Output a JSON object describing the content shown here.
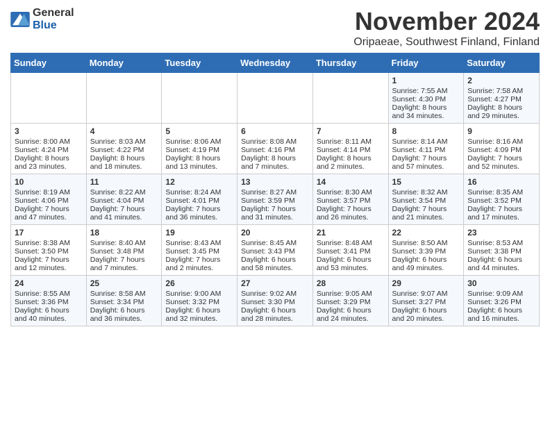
{
  "header": {
    "logo_general": "General",
    "logo_blue": "Blue",
    "title": "November 2024",
    "subtitle": "Oripaeae, Southwest Finland, Finland"
  },
  "columns": [
    "Sunday",
    "Monday",
    "Tuesday",
    "Wednesday",
    "Thursday",
    "Friday",
    "Saturday"
  ],
  "weeks": [
    [
      {
        "day": "",
        "text": ""
      },
      {
        "day": "",
        "text": ""
      },
      {
        "day": "",
        "text": ""
      },
      {
        "day": "",
        "text": ""
      },
      {
        "day": "",
        "text": ""
      },
      {
        "day": "1",
        "text": "Sunrise: 7:55 AM\nSunset: 4:30 PM\nDaylight: 8 hours\nand 34 minutes."
      },
      {
        "day": "2",
        "text": "Sunrise: 7:58 AM\nSunset: 4:27 PM\nDaylight: 8 hours\nand 29 minutes."
      }
    ],
    [
      {
        "day": "3",
        "text": "Sunrise: 8:00 AM\nSunset: 4:24 PM\nDaylight: 8 hours\nand 23 minutes."
      },
      {
        "day": "4",
        "text": "Sunrise: 8:03 AM\nSunset: 4:22 PM\nDaylight: 8 hours\nand 18 minutes."
      },
      {
        "day": "5",
        "text": "Sunrise: 8:06 AM\nSunset: 4:19 PM\nDaylight: 8 hours\nand 13 minutes."
      },
      {
        "day": "6",
        "text": "Sunrise: 8:08 AM\nSunset: 4:16 PM\nDaylight: 8 hours\nand 7 minutes."
      },
      {
        "day": "7",
        "text": "Sunrise: 8:11 AM\nSunset: 4:14 PM\nDaylight: 8 hours\nand 2 minutes."
      },
      {
        "day": "8",
        "text": "Sunrise: 8:14 AM\nSunset: 4:11 PM\nDaylight: 7 hours\nand 57 minutes."
      },
      {
        "day": "9",
        "text": "Sunrise: 8:16 AM\nSunset: 4:09 PM\nDaylight: 7 hours\nand 52 minutes."
      }
    ],
    [
      {
        "day": "10",
        "text": "Sunrise: 8:19 AM\nSunset: 4:06 PM\nDaylight: 7 hours\nand 47 minutes."
      },
      {
        "day": "11",
        "text": "Sunrise: 8:22 AM\nSunset: 4:04 PM\nDaylight: 7 hours\nand 41 minutes."
      },
      {
        "day": "12",
        "text": "Sunrise: 8:24 AM\nSunset: 4:01 PM\nDaylight: 7 hours\nand 36 minutes."
      },
      {
        "day": "13",
        "text": "Sunrise: 8:27 AM\nSunset: 3:59 PM\nDaylight: 7 hours\nand 31 minutes."
      },
      {
        "day": "14",
        "text": "Sunrise: 8:30 AM\nSunset: 3:57 PM\nDaylight: 7 hours\nand 26 minutes."
      },
      {
        "day": "15",
        "text": "Sunrise: 8:32 AM\nSunset: 3:54 PM\nDaylight: 7 hours\nand 21 minutes."
      },
      {
        "day": "16",
        "text": "Sunrise: 8:35 AM\nSunset: 3:52 PM\nDaylight: 7 hours\nand 17 minutes."
      }
    ],
    [
      {
        "day": "17",
        "text": "Sunrise: 8:38 AM\nSunset: 3:50 PM\nDaylight: 7 hours\nand 12 minutes."
      },
      {
        "day": "18",
        "text": "Sunrise: 8:40 AM\nSunset: 3:48 PM\nDaylight: 7 hours\nand 7 minutes."
      },
      {
        "day": "19",
        "text": "Sunrise: 8:43 AM\nSunset: 3:45 PM\nDaylight: 7 hours\nand 2 minutes."
      },
      {
        "day": "20",
        "text": "Sunrise: 8:45 AM\nSunset: 3:43 PM\nDaylight: 6 hours\nand 58 minutes."
      },
      {
        "day": "21",
        "text": "Sunrise: 8:48 AM\nSunset: 3:41 PM\nDaylight: 6 hours\nand 53 minutes."
      },
      {
        "day": "22",
        "text": "Sunrise: 8:50 AM\nSunset: 3:39 PM\nDaylight: 6 hours\nand 49 minutes."
      },
      {
        "day": "23",
        "text": "Sunrise: 8:53 AM\nSunset: 3:38 PM\nDaylight: 6 hours\nand 44 minutes."
      }
    ],
    [
      {
        "day": "24",
        "text": "Sunrise: 8:55 AM\nSunset: 3:36 PM\nDaylight: 6 hours\nand 40 minutes."
      },
      {
        "day": "25",
        "text": "Sunrise: 8:58 AM\nSunset: 3:34 PM\nDaylight: 6 hours\nand 36 minutes."
      },
      {
        "day": "26",
        "text": "Sunrise: 9:00 AM\nSunset: 3:32 PM\nDaylight: 6 hours\nand 32 minutes."
      },
      {
        "day": "27",
        "text": "Sunrise: 9:02 AM\nSunset: 3:30 PM\nDaylight: 6 hours\nand 28 minutes."
      },
      {
        "day": "28",
        "text": "Sunrise: 9:05 AM\nSunset: 3:29 PM\nDaylight: 6 hours\nand 24 minutes."
      },
      {
        "day": "29",
        "text": "Sunrise: 9:07 AM\nSunset: 3:27 PM\nDaylight: 6 hours\nand 20 minutes."
      },
      {
        "day": "30",
        "text": "Sunrise: 9:09 AM\nSunset: 3:26 PM\nDaylight: 6 hours\nand 16 minutes."
      }
    ]
  ]
}
